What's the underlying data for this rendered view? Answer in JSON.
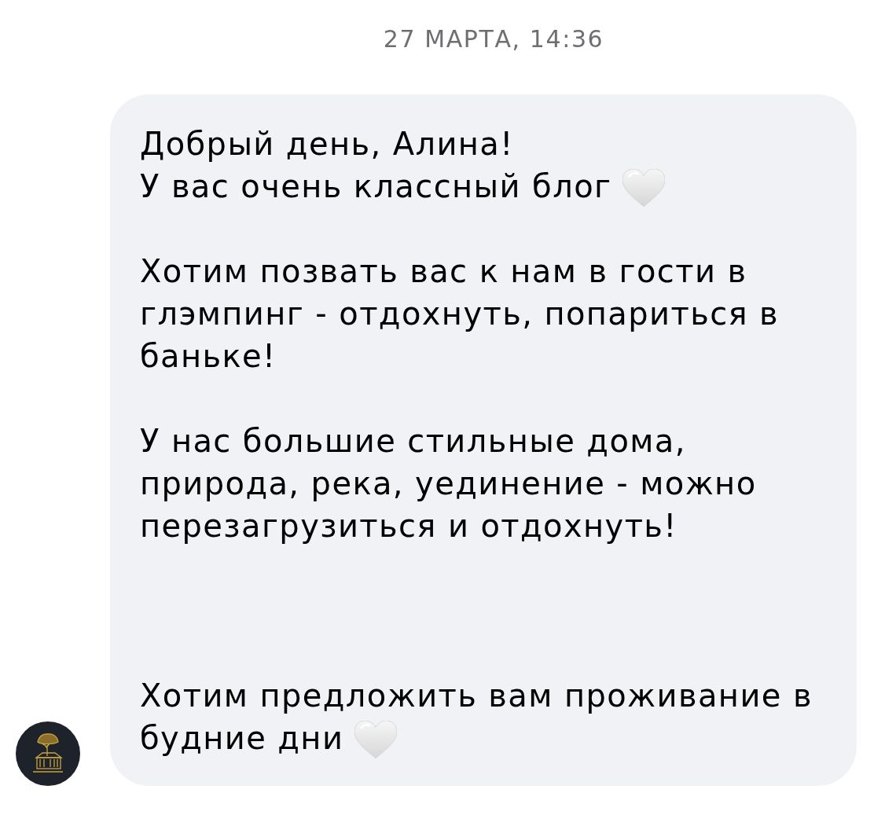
{
  "timestamp": "27 МАРТА, 14:36",
  "message": {
    "paragraphs": [
      {
        "lines": [
          "Добрый день, Алина!",
          "У вас очень классный блог"
        ],
        "trailing_emoji": true
      },
      {
        "lines": [
          "Хотим позвать вас к нам в гости в",
          "глэмпинг - отдохнуть, попариться в",
          "баньке!"
        ],
        "trailing_emoji": false
      },
      {
        "lines": [
          "У нас большие стильные дома,",
          "природа, река, уединение - можно",
          "перезагрузиться и отдохнуть!"
        ],
        "trailing_emoji": false
      },
      {
        "lines": [
          "Хотим предложить вам проживание в",
          "будние дни"
        ],
        "trailing_emoji": true
      }
    ]
  }
}
